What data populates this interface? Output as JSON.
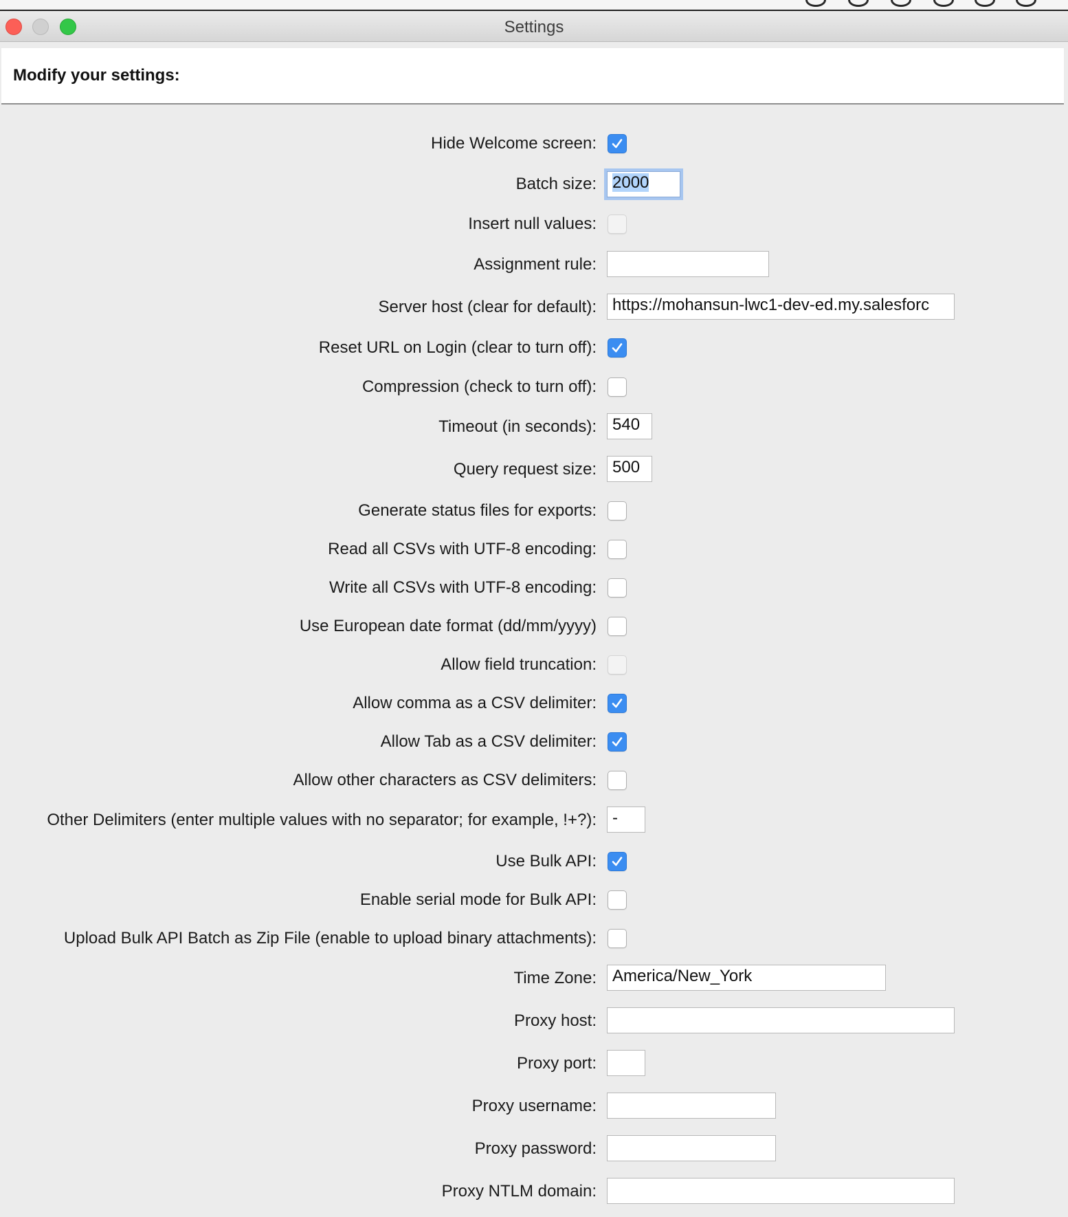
{
  "window": {
    "title": "Settings"
  },
  "panel": {
    "heading": "Modify your settings:"
  },
  "settings": {
    "hide_welcome_screen": {
      "label": "Hide Welcome screen:",
      "checked": true
    },
    "batch_size": {
      "label": "Batch size:",
      "value": "2000"
    },
    "insert_null_values": {
      "label": "Insert null values:",
      "checked": false,
      "disabled": true
    },
    "assignment_rule": {
      "label": "Assignment rule:",
      "value": ""
    },
    "server_host": {
      "label": "Server host (clear for default):",
      "value": "https://mohansun-lwc1-dev-ed.my.salesforc"
    },
    "reset_url_on_login": {
      "label": "Reset URL on Login (clear to turn off):",
      "checked": true
    },
    "compression": {
      "label": "Compression (check to turn off):",
      "checked": false
    },
    "timeout": {
      "label": "Timeout (in seconds):",
      "value": "540"
    },
    "query_request_size": {
      "label": "Query request size:",
      "value": "500"
    },
    "generate_status_files": {
      "label": "Generate status files for exports:",
      "checked": false
    },
    "read_csv_utf8": {
      "label": "Read all CSVs with UTF-8 encoding:",
      "checked": false
    },
    "write_csv_utf8": {
      "label": "Write all CSVs with UTF-8 encoding:",
      "checked": false
    },
    "european_date_format": {
      "label": "Use European date format (dd/mm/yyyy)",
      "checked": false
    },
    "allow_field_truncation": {
      "label": "Allow field truncation:",
      "checked": false,
      "disabled": true
    },
    "allow_comma_delimiter": {
      "label": "Allow comma as a CSV delimiter:",
      "checked": true
    },
    "allow_tab_delimiter": {
      "label": "Allow Tab as a CSV delimiter:",
      "checked": true
    },
    "allow_other_delimiters": {
      "label": "Allow other characters as CSV delimiters:",
      "checked": false
    },
    "other_delimiters": {
      "label": "Other Delimiters (enter multiple values with no separator; for example, !+?):",
      "value": "-"
    },
    "use_bulk_api": {
      "label": "Use Bulk API:",
      "checked": true
    },
    "bulk_api_serial_mode": {
      "label": "Enable serial mode for Bulk API:",
      "checked": false
    },
    "bulk_api_zip_upload": {
      "label": "Upload Bulk API Batch as Zip File (enable to upload binary attachments):",
      "checked": false
    },
    "time_zone": {
      "label": "Time Zone:",
      "value": "America/New_York"
    },
    "proxy_host": {
      "label": "Proxy host:",
      "value": ""
    },
    "proxy_port": {
      "label": "Proxy port:",
      "value": ""
    },
    "proxy_username": {
      "label": "Proxy username:",
      "value": ""
    },
    "proxy_password": {
      "label": "Proxy password:",
      "value": ""
    },
    "proxy_ntlm_domain": {
      "label": "Proxy NTLM domain:",
      "value": ""
    }
  },
  "colors": {
    "accent": "#3b8df1",
    "focus_ring": "#a7c6f0",
    "background": "#ececec"
  }
}
